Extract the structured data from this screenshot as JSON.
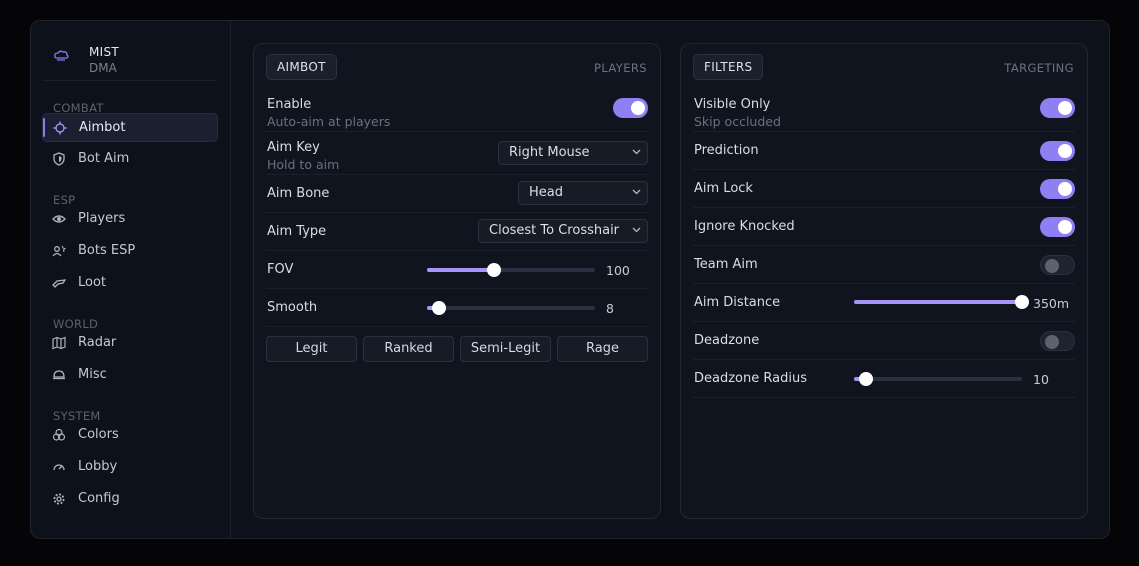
{
  "brand": {
    "title": "MIST",
    "subtitle": "DMA",
    "icon": "cloud-icon"
  },
  "sidebar": {
    "sections": [
      {
        "label": "COMBAT",
        "items": [
          {
            "label": "Aimbot",
            "icon": "crosshair-icon",
            "active": true
          },
          {
            "label": "Bot Aim",
            "icon": "shield-icon",
            "active": false
          }
        ]
      },
      {
        "label": "ESP",
        "items": [
          {
            "label": "Players",
            "icon": "eye-icon"
          },
          {
            "label": "Bots ESP",
            "icon": "user-bot-icon"
          },
          {
            "label": "Loot",
            "icon": "loot-icon"
          }
        ]
      },
      {
        "label": "WORLD",
        "items": [
          {
            "label": "Radar",
            "icon": "map-icon"
          },
          {
            "label": "Misc",
            "icon": "helmet-icon"
          }
        ]
      },
      {
        "label": "SYSTEM",
        "items": [
          {
            "label": "Colors",
            "icon": "palette-icon"
          },
          {
            "label": "Lobby",
            "icon": "gauge-icon"
          },
          {
            "label": "Config",
            "icon": "gear-icon"
          }
        ]
      }
    ]
  },
  "left_panel": {
    "tab": "AIMBOT",
    "right_label": "PLAYERS",
    "enable": {
      "label": "Enable",
      "sub": "Auto-aim at players",
      "on": true
    },
    "aim_key": {
      "label": "Aim Key",
      "sub": "Hold to aim",
      "value": "Right Mouse"
    },
    "aim_bone": {
      "label": "Aim Bone",
      "value": "Head"
    },
    "aim_type": {
      "label": "Aim Type",
      "value": "Closest To Crosshair"
    },
    "fov": {
      "label": "FOV",
      "value": "100",
      "fraction": 0.4
    },
    "smooth": {
      "label": "Smooth",
      "value": "8",
      "fraction": 0.07
    },
    "presets": [
      "Legit",
      "Ranked",
      "Semi-Legit",
      "Rage"
    ]
  },
  "right_panel": {
    "tab": "FILTERS",
    "right_label": "TARGETING",
    "visible_only": {
      "label": "Visible Only",
      "sub": "Skip occluded",
      "on": true
    },
    "prediction": {
      "label": "Prediction",
      "on": true
    },
    "aim_lock": {
      "label": "Aim Lock",
      "on": true
    },
    "ignore_knocked": {
      "label": "Ignore Knocked",
      "on": true
    },
    "team_aim": {
      "label": "Team Aim",
      "on": false
    },
    "aim_distance": {
      "label": "Aim Distance",
      "value": "350m",
      "fraction": 1.0
    },
    "deadzone": {
      "label": "Deadzone",
      "on": false
    },
    "deadzone_radius": {
      "label": "Deadzone Radius",
      "value": "10",
      "fraction": 0.07
    }
  },
  "colors": {
    "accent": "#8f7ff3",
    "slider_fill": "#a796f7",
    "background": "#0d111a",
    "panel": "#10141e"
  }
}
